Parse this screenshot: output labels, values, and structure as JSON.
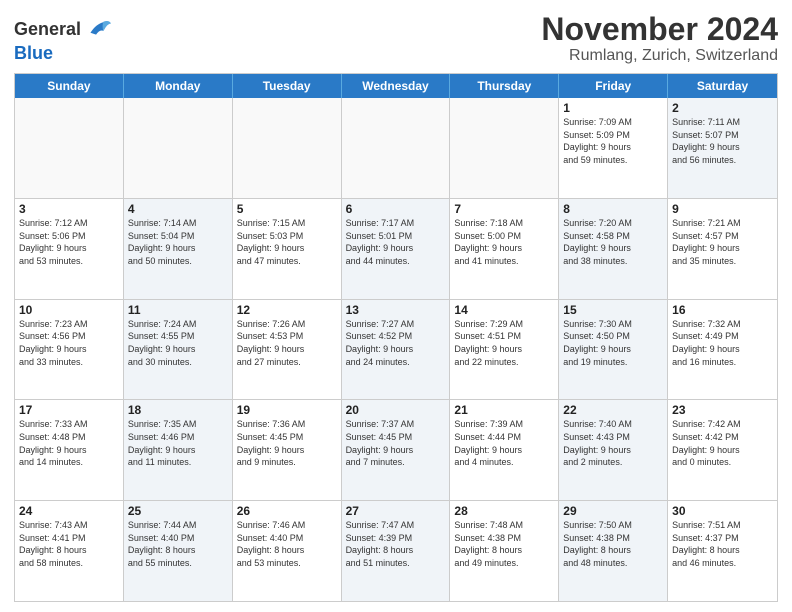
{
  "header": {
    "logo_line1": "General",
    "logo_line2": "Blue",
    "title": "November 2024",
    "subtitle": "Rumlang, Zurich, Switzerland"
  },
  "calendar": {
    "days_of_week": [
      "Sunday",
      "Monday",
      "Tuesday",
      "Wednesday",
      "Thursday",
      "Friday",
      "Saturday"
    ],
    "rows": [
      [
        {
          "day": "",
          "info": "",
          "shade": false,
          "empty": true
        },
        {
          "day": "",
          "info": "",
          "shade": false,
          "empty": true
        },
        {
          "day": "",
          "info": "",
          "shade": false,
          "empty": true
        },
        {
          "day": "",
          "info": "",
          "shade": false,
          "empty": true
        },
        {
          "day": "",
          "info": "",
          "shade": false,
          "empty": true
        },
        {
          "day": "1",
          "info": "Sunrise: 7:09 AM\nSunset: 5:09 PM\nDaylight: 9 hours\nand 59 minutes.",
          "shade": false,
          "empty": false
        },
        {
          "day": "2",
          "info": "Sunrise: 7:11 AM\nSunset: 5:07 PM\nDaylight: 9 hours\nand 56 minutes.",
          "shade": true,
          "empty": false
        }
      ],
      [
        {
          "day": "3",
          "info": "Sunrise: 7:12 AM\nSunset: 5:06 PM\nDaylight: 9 hours\nand 53 minutes.",
          "shade": false,
          "empty": false
        },
        {
          "day": "4",
          "info": "Sunrise: 7:14 AM\nSunset: 5:04 PM\nDaylight: 9 hours\nand 50 minutes.",
          "shade": true,
          "empty": false
        },
        {
          "day": "5",
          "info": "Sunrise: 7:15 AM\nSunset: 5:03 PM\nDaylight: 9 hours\nand 47 minutes.",
          "shade": false,
          "empty": false
        },
        {
          "day": "6",
          "info": "Sunrise: 7:17 AM\nSunset: 5:01 PM\nDaylight: 9 hours\nand 44 minutes.",
          "shade": true,
          "empty": false
        },
        {
          "day": "7",
          "info": "Sunrise: 7:18 AM\nSunset: 5:00 PM\nDaylight: 9 hours\nand 41 minutes.",
          "shade": false,
          "empty": false
        },
        {
          "day": "8",
          "info": "Sunrise: 7:20 AM\nSunset: 4:58 PM\nDaylight: 9 hours\nand 38 minutes.",
          "shade": true,
          "empty": false
        },
        {
          "day": "9",
          "info": "Sunrise: 7:21 AM\nSunset: 4:57 PM\nDaylight: 9 hours\nand 35 minutes.",
          "shade": false,
          "empty": false
        }
      ],
      [
        {
          "day": "10",
          "info": "Sunrise: 7:23 AM\nSunset: 4:56 PM\nDaylight: 9 hours\nand 33 minutes.",
          "shade": false,
          "empty": false
        },
        {
          "day": "11",
          "info": "Sunrise: 7:24 AM\nSunset: 4:55 PM\nDaylight: 9 hours\nand 30 minutes.",
          "shade": true,
          "empty": false
        },
        {
          "day": "12",
          "info": "Sunrise: 7:26 AM\nSunset: 4:53 PM\nDaylight: 9 hours\nand 27 minutes.",
          "shade": false,
          "empty": false
        },
        {
          "day": "13",
          "info": "Sunrise: 7:27 AM\nSunset: 4:52 PM\nDaylight: 9 hours\nand 24 minutes.",
          "shade": true,
          "empty": false
        },
        {
          "day": "14",
          "info": "Sunrise: 7:29 AM\nSunset: 4:51 PM\nDaylight: 9 hours\nand 22 minutes.",
          "shade": false,
          "empty": false
        },
        {
          "day": "15",
          "info": "Sunrise: 7:30 AM\nSunset: 4:50 PM\nDaylight: 9 hours\nand 19 minutes.",
          "shade": true,
          "empty": false
        },
        {
          "day": "16",
          "info": "Sunrise: 7:32 AM\nSunset: 4:49 PM\nDaylight: 9 hours\nand 16 minutes.",
          "shade": false,
          "empty": false
        }
      ],
      [
        {
          "day": "17",
          "info": "Sunrise: 7:33 AM\nSunset: 4:48 PM\nDaylight: 9 hours\nand 14 minutes.",
          "shade": false,
          "empty": false
        },
        {
          "day": "18",
          "info": "Sunrise: 7:35 AM\nSunset: 4:46 PM\nDaylight: 9 hours\nand 11 minutes.",
          "shade": true,
          "empty": false
        },
        {
          "day": "19",
          "info": "Sunrise: 7:36 AM\nSunset: 4:45 PM\nDaylight: 9 hours\nand 9 minutes.",
          "shade": false,
          "empty": false
        },
        {
          "day": "20",
          "info": "Sunrise: 7:37 AM\nSunset: 4:45 PM\nDaylight: 9 hours\nand 7 minutes.",
          "shade": true,
          "empty": false
        },
        {
          "day": "21",
          "info": "Sunrise: 7:39 AM\nSunset: 4:44 PM\nDaylight: 9 hours\nand 4 minutes.",
          "shade": false,
          "empty": false
        },
        {
          "day": "22",
          "info": "Sunrise: 7:40 AM\nSunset: 4:43 PM\nDaylight: 9 hours\nand 2 minutes.",
          "shade": true,
          "empty": false
        },
        {
          "day": "23",
          "info": "Sunrise: 7:42 AM\nSunset: 4:42 PM\nDaylight: 9 hours\nand 0 minutes.",
          "shade": false,
          "empty": false
        }
      ],
      [
        {
          "day": "24",
          "info": "Sunrise: 7:43 AM\nSunset: 4:41 PM\nDaylight: 8 hours\nand 58 minutes.",
          "shade": false,
          "empty": false
        },
        {
          "day": "25",
          "info": "Sunrise: 7:44 AM\nSunset: 4:40 PM\nDaylight: 8 hours\nand 55 minutes.",
          "shade": true,
          "empty": false
        },
        {
          "day": "26",
          "info": "Sunrise: 7:46 AM\nSunset: 4:40 PM\nDaylight: 8 hours\nand 53 minutes.",
          "shade": false,
          "empty": false
        },
        {
          "day": "27",
          "info": "Sunrise: 7:47 AM\nSunset: 4:39 PM\nDaylight: 8 hours\nand 51 minutes.",
          "shade": true,
          "empty": false
        },
        {
          "day": "28",
          "info": "Sunrise: 7:48 AM\nSunset: 4:38 PM\nDaylight: 8 hours\nand 49 minutes.",
          "shade": false,
          "empty": false
        },
        {
          "day": "29",
          "info": "Sunrise: 7:50 AM\nSunset: 4:38 PM\nDaylight: 8 hours\nand 48 minutes.",
          "shade": true,
          "empty": false
        },
        {
          "day": "30",
          "info": "Sunrise: 7:51 AM\nSunset: 4:37 PM\nDaylight: 8 hours\nand 46 minutes.",
          "shade": false,
          "empty": false
        }
      ]
    ]
  }
}
